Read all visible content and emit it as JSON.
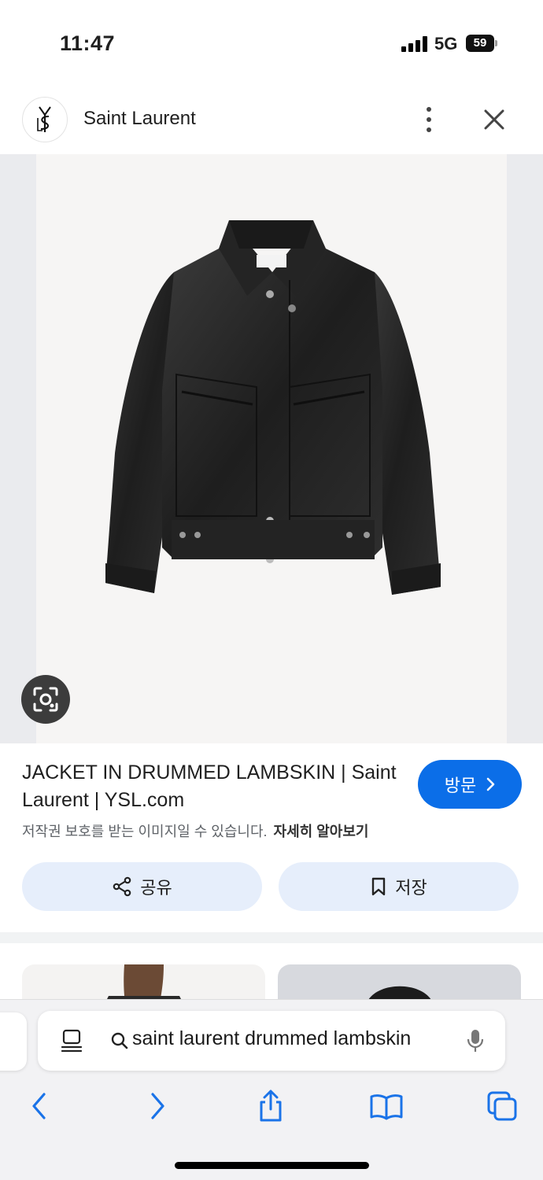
{
  "status_bar": {
    "time": "11:47",
    "network": "5G",
    "battery": "59"
  },
  "header": {
    "site_name": "Saint Laurent",
    "logo_icon": "ysl-logo-icon",
    "more_icon": "more-vertical-icon",
    "close_icon": "close-icon"
  },
  "result": {
    "title": "JACKET IN DRUMMED LAMBSKIN | Saint Laurent | YSL.com",
    "visit_label": "방문",
    "copyright_notice": "저작권 보호를 받는 이미지일 수 있습니다.",
    "learn_more": "자세히 알아보기",
    "share_label": "공유",
    "save_label": "저장"
  },
  "browser": {
    "address_text": "saint laurent drummed lambskin",
    "icons": [
      "reader-icon",
      "search-icon",
      "mic-icon",
      "back-icon",
      "forward-icon",
      "share-icon",
      "bookmarks-icon",
      "tabs-icon"
    ]
  },
  "colors": {
    "accent": "#0b6ee8",
    "pill_bg": "#e6eefb"
  }
}
